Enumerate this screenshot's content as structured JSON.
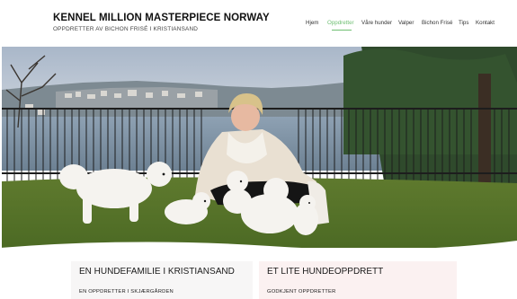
{
  "site": {
    "title": "KENNEL MILLION MASTERPIECE NORWAY",
    "subtitle": "OPPDRETTER AV BICHON FRISÉ I KRISTIANSAND"
  },
  "nav": {
    "items": [
      {
        "label": "Hjem"
      },
      {
        "label": "Oppdretter",
        "active": true
      },
      {
        "label": "Våre hunder"
      },
      {
        "label": "Valper"
      },
      {
        "label": "Bichon Frisé"
      },
      {
        "label": "Tips"
      },
      {
        "label": "Kontakt"
      }
    ]
  },
  "hero": {
    "image": "woman-with-bichon-frise-dogs-photo"
  },
  "cards": [
    {
      "title": "EN HUNDEFAMILIE I KRISTIANSAND",
      "subtitle": "EN OPPDRETTER I SKJÆRGÅRDEN"
    },
    {
      "title": "ET LITE HUNDEOPPDRETT",
      "subtitle": "GODKJENT OPPDRETTER"
    }
  ],
  "colors": {
    "accent": "#6fbf73",
    "text": "#111111",
    "card_left_bg": "#f7f6f6",
    "card_right_bg": "#fbf1f1"
  }
}
